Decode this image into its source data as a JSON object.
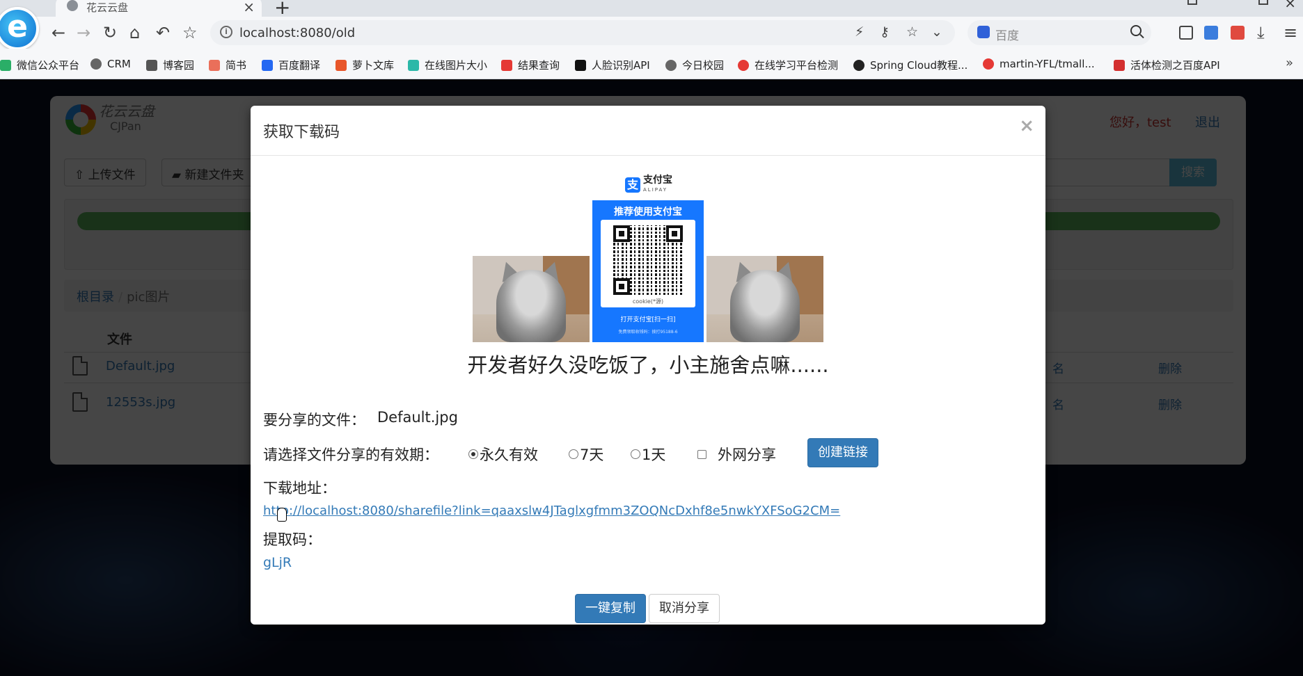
{
  "browser": {
    "tab_title": "花云云盘",
    "url": "localhost:8080/old",
    "search_placeholder": "百度",
    "bookmarks": [
      {
        "label": "微信公众平台",
        "color": "#2aae67"
      },
      {
        "label": "CRM",
        "color": "#666666"
      },
      {
        "label": "博客园",
        "color": "#555555"
      },
      {
        "label": "简书",
        "color": "#ea6f5a"
      },
      {
        "label": "百度翻译",
        "color": "#2468f2"
      },
      {
        "label": "萝卜文库",
        "color": "#e8562a"
      },
      {
        "label": "在线图片大小",
        "color": "#2cb8a8"
      },
      {
        "label": "结果查询",
        "color": "#e53935"
      },
      {
        "label": "人脸识别API",
        "color": "#111111"
      },
      {
        "label": "今日校园",
        "color": "#666666"
      },
      {
        "label": "在线学习平台检测",
        "color": "#e53935"
      },
      {
        "label": "Spring Cloud教程...",
        "color": "#222222"
      },
      {
        "label": "martin-YFL/tmall...",
        "color": "#e53935"
      },
      {
        "label": "活体检测之百度API",
        "color": "#d32f2f"
      }
    ],
    "more": "»"
  },
  "app": {
    "name": "花云云盘",
    "subname": "CJPan",
    "greeting": "您好，test",
    "logout": "退出",
    "upload_button": "上传文件",
    "new_folder_button": "新建文件夹",
    "search_button": "搜索",
    "progress_percent": 100,
    "breadcrumb": {
      "root": "根目录",
      "separator": "/",
      "current": "pic图片"
    },
    "table": {
      "header_file": "文件",
      "rows": [
        {
          "name": "Default.jpg",
          "rename": "名",
          "delete": "删除"
        },
        {
          "name": "12553s.jpg",
          "rename": "名",
          "delete": "删除"
        }
      ]
    }
  },
  "modal": {
    "title": "获取下载码",
    "close": "×",
    "alipay_logo": "支付宝",
    "alipay_logo_sub": "ALIPAY",
    "qr_title": "推荐使用支付宝",
    "qr_caption": "cookie(*源)",
    "qr_footer": "打开支付宝[扫一扫]",
    "qr_footer_small": "免费领取收钱码：拨打95188-6",
    "beg_text": "开发者好久没吃饭了，小主施舍点嘛......",
    "file_label": "要分享的文件：",
    "file_name": "Default.jpg",
    "validity_label": "请选择文件分享的有效期：",
    "options": [
      {
        "label": "永久有效",
        "selected": true
      },
      {
        "label": "7天",
        "selected": false
      },
      {
        "label": "1天",
        "selected": false
      }
    ],
    "external_share_label": "外网分享",
    "create_link_button": "创建链接",
    "download_label": "下载地址：",
    "download_url": "http://localhost:8080/sharefile?link=qaaxslw4JTaglxgfmm3ZOQNcDxhf8e5nwkYXFSoG2CM=",
    "code_label": "提取码：",
    "code_value": "gLjR",
    "copy_button": "一键复制",
    "cancel_button": "取消分享"
  }
}
